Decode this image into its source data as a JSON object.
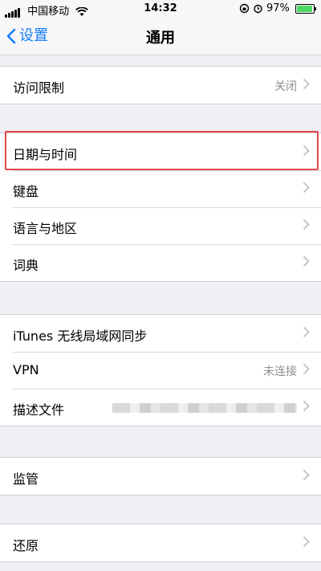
{
  "status_bar": {
    "carrier": "中国移动",
    "time": "14:32",
    "battery": "97%",
    "battery_level": 0.97,
    "icons": [
      "signal-icon",
      "wifi-icon",
      "orientation-lock-icon",
      "alarm-icon",
      "battery-icon"
    ]
  },
  "nav": {
    "back_label": "设置",
    "title": "通用"
  },
  "groups": [
    {
      "rows": [
        {
          "label": "访问限制",
          "value": "关闭"
        }
      ]
    },
    {
      "rows": [
        {
          "label": "日期与时间"
        },
        {
          "label": "键盘"
        },
        {
          "label": "语言与地区"
        },
        {
          "label": "词典"
        }
      ]
    },
    {
      "rows": [
        {
          "label": "iTunes 无线局域网同步"
        },
        {
          "label": "VPN",
          "value": "未连接"
        },
        {
          "label": "描述文件"
        }
      ]
    },
    {
      "rows": [
        {
          "label": "监管"
        }
      ]
    },
    {
      "rows": [
        {
          "label": "还原"
        }
      ]
    }
  ],
  "colors": {
    "accent": "#157efb",
    "highlight_border": "#e34848",
    "background": "#efeff4"
  }
}
